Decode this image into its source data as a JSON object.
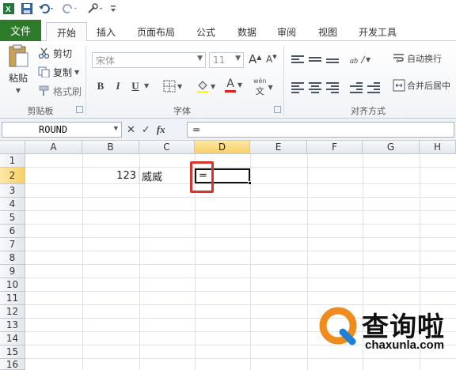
{
  "ribbon_tabs": [
    "文件",
    "开始",
    "插入",
    "页面布局",
    "公式",
    "数据",
    "审阅",
    "视图",
    "开发工具"
  ],
  "clipboard": {
    "paste": "粘贴",
    "cut": "剪切",
    "copy": "复制",
    "format_painter": "格式刷",
    "group": "剪贴板"
  },
  "font": {
    "family": "宋体",
    "size": "11",
    "group": "字体",
    "bold": "B",
    "italic": "I",
    "underline": "U",
    "font_color": "A",
    "grow": "A",
    "shrink": "A",
    "wen": "wén"
  },
  "alignment": {
    "wrap_text": "自动换行",
    "merge_center": "合并后居中",
    "group": "对齐方式"
  },
  "formula_bar": {
    "name_box": "ROUND",
    "fx": "fx",
    "content": "="
  },
  "columns": [
    "A",
    "B",
    "C",
    "D",
    "E",
    "F",
    "G",
    "H"
  ],
  "selected_column": "D",
  "rows": [
    "1",
    "2",
    "3",
    "4",
    "5",
    "6",
    "7",
    "8",
    "9",
    "10",
    "11",
    "12",
    "13",
    "14",
    "15",
    "16"
  ],
  "selected_row": "2",
  "cells": {
    "B2": "123",
    "C2": "威威",
    "D2": "="
  },
  "watermark": {
    "brand": "查询啦",
    "url": "chaxunla.com"
  },
  "colors": {
    "file_tab": "#2c7a2a",
    "selected_header": "#f7cf67",
    "highlight_box": "#d9342b",
    "watermark_orange": "#f08c1e",
    "watermark_blue": "#1e7fd6"
  }
}
